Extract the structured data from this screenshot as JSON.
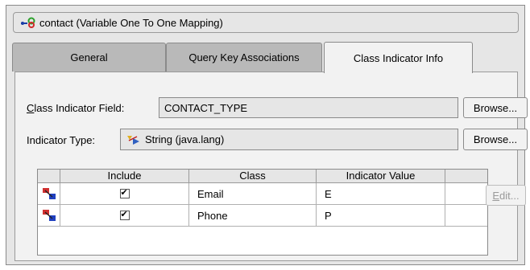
{
  "title": "contact (Variable One To One Mapping)",
  "tabs": [
    {
      "label": "General",
      "active": false
    },
    {
      "label": "Query Key Associations",
      "active": false
    },
    {
      "label": "Class Indicator Info",
      "active": true
    }
  ],
  "class_indicator_field": {
    "label_prefix": "C",
    "label_rest": "lass Indicator Field:",
    "value": "CONTACT_TYPE",
    "browse_label": "Browse..."
  },
  "indicator_type": {
    "label": "Indicator Type:",
    "value": "String (java.lang)",
    "icon": "class-type-icon",
    "browse_label": "Browse..."
  },
  "table": {
    "columns": [
      "Include",
      "Class",
      "Indicator Value"
    ],
    "rows": [
      {
        "include": true,
        "class": "Email",
        "indicator_value": "E"
      },
      {
        "include": true,
        "class": "Phone",
        "indicator_value": "P"
      }
    ]
  },
  "edit_button": {
    "label_prefix": "E",
    "label_rest": "dit...",
    "enabled": false
  },
  "colors": {
    "panel": "#e6e6e6",
    "tab_inactive": "#b9b9b9",
    "content": "#f2f2f2"
  }
}
